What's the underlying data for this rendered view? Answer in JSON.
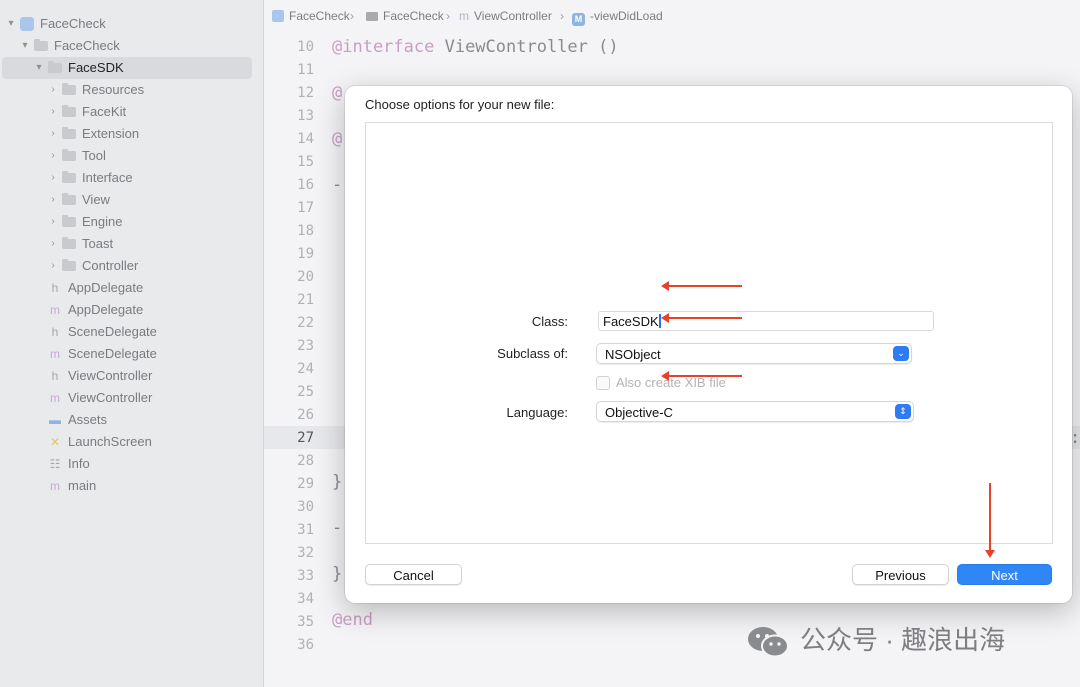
{
  "sidebar": {
    "items": [
      {
        "label": "FaceCheck",
        "kind": "project",
        "depth": 0,
        "expanded": true
      },
      {
        "label": "FaceCheck",
        "kind": "folder",
        "depth": 1,
        "expanded": true
      },
      {
        "label": "FaceSDK",
        "kind": "folder",
        "depth": 2,
        "expanded": true,
        "selected": true
      },
      {
        "label": "Resources",
        "kind": "folder",
        "depth": 3,
        "expanded": false
      },
      {
        "label": "FaceKit",
        "kind": "folder",
        "depth": 3,
        "expanded": false
      },
      {
        "label": "Extension",
        "kind": "folder",
        "depth": 3,
        "expanded": false
      },
      {
        "label": "Tool",
        "kind": "folder",
        "depth": 3,
        "expanded": false
      },
      {
        "label": "Interface",
        "kind": "folder",
        "depth": 3,
        "expanded": false
      },
      {
        "label": "View",
        "kind": "folder",
        "depth": 3,
        "expanded": false
      },
      {
        "label": "Engine",
        "kind": "folder",
        "depth": 3,
        "expanded": false
      },
      {
        "label": "Toast",
        "kind": "folder",
        "depth": 3,
        "expanded": false
      },
      {
        "label": "Controller",
        "kind": "folder",
        "depth": 3,
        "expanded": false
      },
      {
        "label": "AppDelegate",
        "kind": "h",
        "depth": 2
      },
      {
        "label": "AppDelegate",
        "kind": "m",
        "depth": 2
      },
      {
        "label": "SceneDelegate",
        "kind": "h",
        "depth": 2
      },
      {
        "label": "SceneDelegate",
        "kind": "m",
        "depth": 2
      },
      {
        "label": "ViewController",
        "kind": "h",
        "depth": 2
      },
      {
        "label": "ViewController",
        "kind": "m",
        "depth": 2
      },
      {
        "label": "Assets",
        "kind": "assets",
        "depth": 2
      },
      {
        "label": "LaunchScreen",
        "kind": "launch",
        "depth": 2
      },
      {
        "label": "Info",
        "kind": "info",
        "depth": 2
      },
      {
        "label": "main",
        "kind": "m",
        "depth": 2
      }
    ]
  },
  "breadcrumb": {
    "items": [
      "FaceCheck",
      "FaceCheck",
      "ViewController",
      "-viewDidLoad"
    ],
    "separator": "›"
  },
  "editor": {
    "line_numbers": [
      "10",
      "11",
      "12",
      "13",
      "14",
      "15",
      "16",
      "17",
      "18",
      "19",
      "20",
      "21",
      "22",
      "23",
      "24",
      "25",
      "26",
      "27",
      "28",
      "29",
      "30",
      "31",
      "32",
      "33",
      "34",
      "35",
      "36"
    ],
    "current_line": "27",
    "code": {
      "line10_kw": "@interface",
      "line10_rest": " ViewController ()",
      "line12": "@",
      "line14": "@",
      "line16": "-",
      "line29": "}",
      "line31": "-",
      "line33": "}",
      "line35": "@end",
      "line27_tail": ":"
    }
  },
  "dialog": {
    "title": "Choose options for your new file:",
    "class_label": "Class:",
    "class_value": "FaceSDK",
    "subclass_label": "Subclass of:",
    "subclass_value": "NSObject",
    "xib_label": "Also create XIB file",
    "language_label": "Language:",
    "language_value": "Objective-C",
    "cancel_label": "Cancel",
    "previous_label": "Previous",
    "next_label": "Next"
  },
  "icons": {
    "disclosure_open": "▾",
    "disclosure_closed": "›",
    "popup_down": "⌄",
    "popup_updown": "⇕",
    "file_h": "h",
    "file_m": "m",
    "method_M": "M"
  },
  "watermark": {
    "text": "公众号 · 趣浪出海"
  },
  "colors": {
    "accent": "#2f86f6",
    "annotation": "#e8412c"
  }
}
